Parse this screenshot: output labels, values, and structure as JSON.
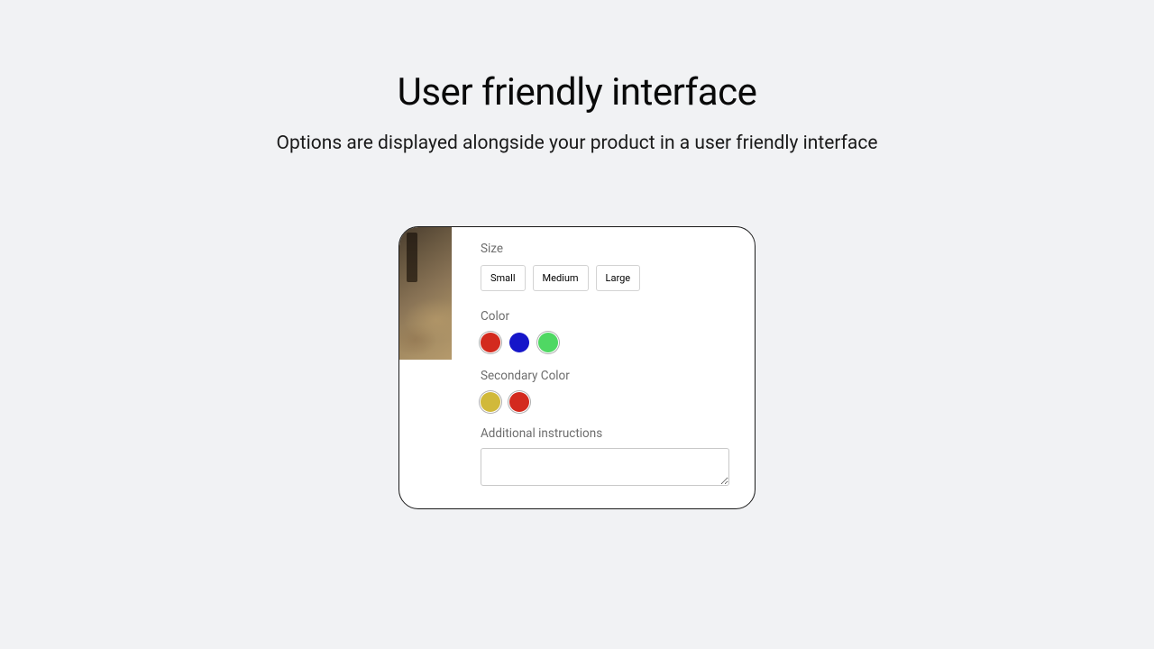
{
  "header": {
    "title": "User friendly interface",
    "subtitle": "Options are displayed alongside your product in a user friendly interface"
  },
  "options": {
    "size": {
      "label": "Size",
      "values": [
        "Small",
        "Medium",
        "Large"
      ]
    },
    "color": {
      "label": "Color",
      "swatches": [
        {
          "name": "red",
          "hex": "#d32a1e",
          "selected": true
        },
        {
          "name": "blue",
          "hex": "#1616c9",
          "selected": false
        },
        {
          "name": "green",
          "hex": "#4fd863",
          "selected": true
        }
      ]
    },
    "secondary_color": {
      "label": "Secondary Color",
      "swatches": [
        {
          "name": "gold",
          "hex": "#d1b93a",
          "selected": true
        },
        {
          "name": "red",
          "hex": "#d32a1e",
          "selected": true
        }
      ]
    },
    "instructions": {
      "label": "Additional instructions",
      "value": ""
    }
  }
}
